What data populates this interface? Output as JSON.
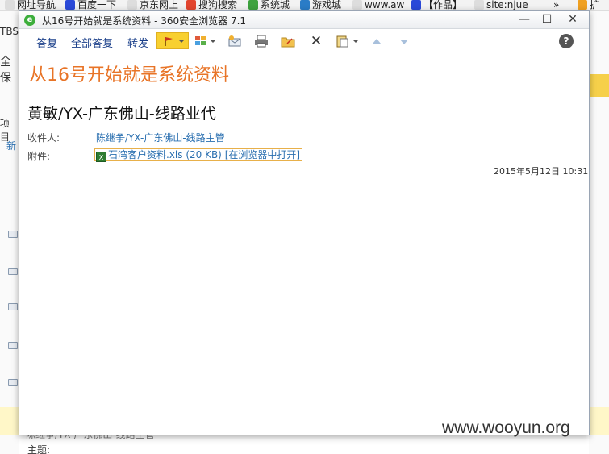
{
  "bookmarks": [
    {
      "label": "网址导航",
      "icon": "page-icon",
      "color": "#dddddd"
    },
    {
      "label": "百度一下",
      "icon": "paw-icon",
      "color": "#2a49d8"
    },
    {
      "label": "京东网上",
      "icon": "page-icon",
      "color": "#dddddd"
    },
    {
      "label": "搜狗搜索",
      "icon": "sogou-icon",
      "color": "#e2452e"
    },
    {
      "label": "系统城",
      "icon": "leaf-icon",
      "color": "#3ea23e"
    },
    {
      "label": "游戏城",
      "icon": "cheng-icon",
      "color": "#2a7cc7"
    },
    {
      "label": "www.aw",
      "icon": "page-icon",
      "color": "#dddddd"
    },
    {
      "label": "【作品】",
      "icon": "paw-icon",
      "color": "#2a49d8"
    },
    {
      "label": "site:njue",
      "icon": "page-icon",
      "color": "#dddddd"
    }
  ],
  "bookmarks_more": "»",
  "bookmarks_ext": "扩",
  "background": {
    "left_texts": [
      "TBS",
      "全保",
      "项目",
      "新"
    ],
    "bottom_text": "陈继争/YX-广东佛山-线路主管",
    "bottom_text2": "主题:"
  },
  "window": {
    "title": "从16号开始就是系统资料 - 360安全浏览器 7.1",
    "minimize": "—",
    "maximize": "☐",
    "close": "✕"
  },
  "toolbar": {
    "reply": "答复",
    "reply_all": "全部答复",
    "forward": "转发",
    "flag_color": "#f8d030"
  },
  "email": {
    "subject": "从16号开始就是系统资料",
    "sender": "黄敏/YX-广东佛山-线路业代",
    "recipient_label": "收件人:",
    "recipient": "陈继争/YX-广东佛山-线路主管",
    "attachment_label": "附件:",
    "attachment_name": "石湾客户资料.xls (20 KB)",
    "attachment_action": "[在浏览器中打开]",
    "date": "2015年5月12日 10:31"
  },
  "watermark": "www.wooyun.org"
}
